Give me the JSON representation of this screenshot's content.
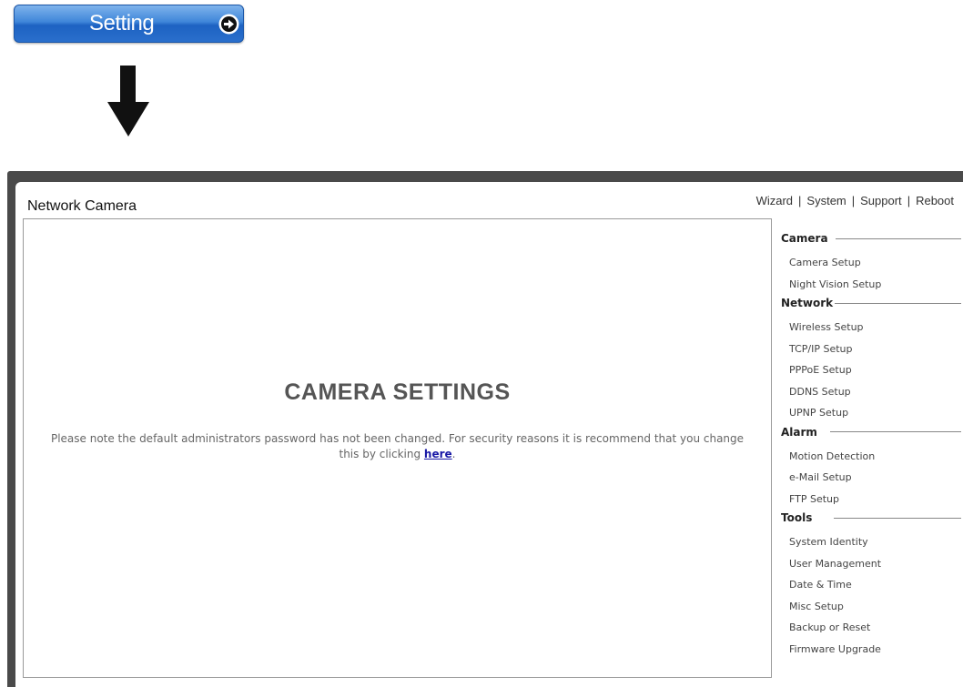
{
  "setting_button": {
    "label": "Setting",
    "icon": "arrow-right-circle-icon"
  },
  "down_arrow": {
    "icon": "arrow-down-icon"
  },
  "header": {
    "title": "Network Camera",
    "nav": [
      {
        "label": "Wizard"
      },
      {
        "label": "System"
      },
      {
        "label": "Support"
      },
      {
        "label": "Reboot"
      }
    ],
    "separator": "|"
  },
  "main": {
    "heading": "CAMERA SETTINGS",
    "notice_text": "Please note the default administrators password has not been changed. For security reasons it is recommend that you change this by clicking ",
    "notice_link": "here",
    "notice_end": "."
  },
  "sidebar": {
    "sections": [
      {
        "title": "Camera",
        "items": [
          "Camera Setup",
          "Night Vision Setup"
        ]
      },
      {
        "title": "Network",
        "items": [
          "Wireless Setup",
          "TCP/IP Setup",
          "PPPoE Setup",
          "DDNS Setup",
          "UPNP Setup"
        ]
      },
      {
        "title": "Alarm",
        "items": [
          "Motion Detection",
          "e-Mail Setup",
          "FTP Setup"
        ]
      },
      {
        "title": "Tools",
        "items": [
          "System Identity",
          "User Management",
          "Date & Time",
          "Misc Setup",
          "Backup or Reset",
          "Firmware Upgrade"
        ]
      }
    ]
  },
  "colors": {
    "button_blue": "#2a6fcc",
    "frame_dark": "#4a4a4a",
    "link_blue": "#1a1aa6"
  }
}
